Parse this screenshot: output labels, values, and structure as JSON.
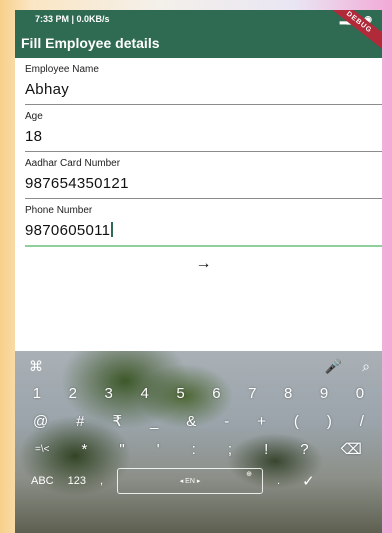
{
  "status_bar": {
    "time": "7:33 PM | 0.0KB/s",
    "signal": "▂▄▆",
    "wifi": "◉"
  },
  "ribbon": "DEBUG",
  "app_bar": {
    "title": "Fill Employee details"
  },
  "form": {
    "fields": [
      {
        "label": "Employee Name",
        "value": "Abhay"
      },
      {
        "label": "Age",
        "value": "18"
      },
      {
        "label": "Aadhar Card Number",
        "value": "987654350121"
      },
      {
        "label": "Phone Number",
        "value": "9870605011"
      }
    ],
    "submit_icon": "→"
  },
  "keyboard": {
    "top_left": "⌘",
    "top_mic": "🎤",
    "top_search": "⌕",
    "row1": [
      "1",
      "2",
      "3",
      "4",
      "5",
      "6",
      "7",
      "8",
      "9",
      "0"
    ],
    "row2": [
      "@",
      "#",
      "₹",
      "_",
      "&",
      "-",
      "+",
      "(",
      ")",
      "/"
    ],
    "row3": [
      "=\\<",
      "*",
      "\"",
      "'",
      ":",
      ";",
      "!",
      "?",
      "⌫"
    ],
    "bottom": {
      "abc": "ABC",
      "num": "123",
      "comma": ",",
      "space": "◂ EN ▸",
      "globe": "⊕",
      "period": ".",
      "enter": "✓"
    }
  }
}
